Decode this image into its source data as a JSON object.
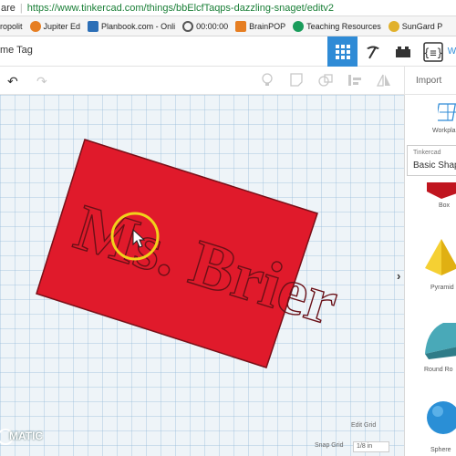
{
  "browser": {
    "url_prefix": "are",
    "url": "https://www.tinkercad.com/things/bbElcfTaqps-dazzling-snaget/editv2"
  },
  "bookmarks": [
    {
      "label": "ropolit",
      "icon": "cityscape-icon",
      "color": "#c0392b"
    },
    {
      "label": "Jupiter Ed",
      "icon": "jupiter-icon",
      "color": "#e67e22"
    },
    {
      "label": "Planbook.com - Onli",
      "icon": "planbook-icon",
      "color": "#2c6fb7"
    },
    {
      "label": "00:00:00",
      "icon": "stopwatch-icon",
      "color": "#555555"
    },
    {
      "label": "BrainPOP",
      "icon": "brainpop-icon",
      "color": "#e67e22"
    },
    {
      "label": "Teaching Resources",
      "icon": "tpt-icon",
      "color": "#1a9c5b"
    },
    {
      "label": "SunGard P",
      "icon": "sungard-icon",
      "color": "#e1b12c"
    }
  ],
  "app": {
    "title": "me Tag",
    "import_label": "Import",
    "accent": "#2f8bd6"
  },
  "workplane": {
    "plate_color": "#e01a2b",
    "plate_text": "Ms. Brier",
    "cursor_ring_color": "#f1d21b"
  },
  "panel": {
    "workplane_label": "Workpla",
    "library_source": "Tinkercad",
    "library_name": "Basic Shap",
    "shapes": [
      {
        "label": "Box",
        "color": "#c0151f"
      },
      {
        "label": "Pyramid",
        "color": "#f0c419"
      },
      {
        "label": "Round Ro",
        "color": "#49a9b8"
      },
      {
        "label": "Sphere",
        "color": "#2a8fd6"
      }
    ]
  },
  "footer": {
    "edit_grid": "Edit Grid",
    "snap_grid": "Snap Grid",
    "snap_value": "1/8 in",
    "brand": "MATIC"
  }
}
